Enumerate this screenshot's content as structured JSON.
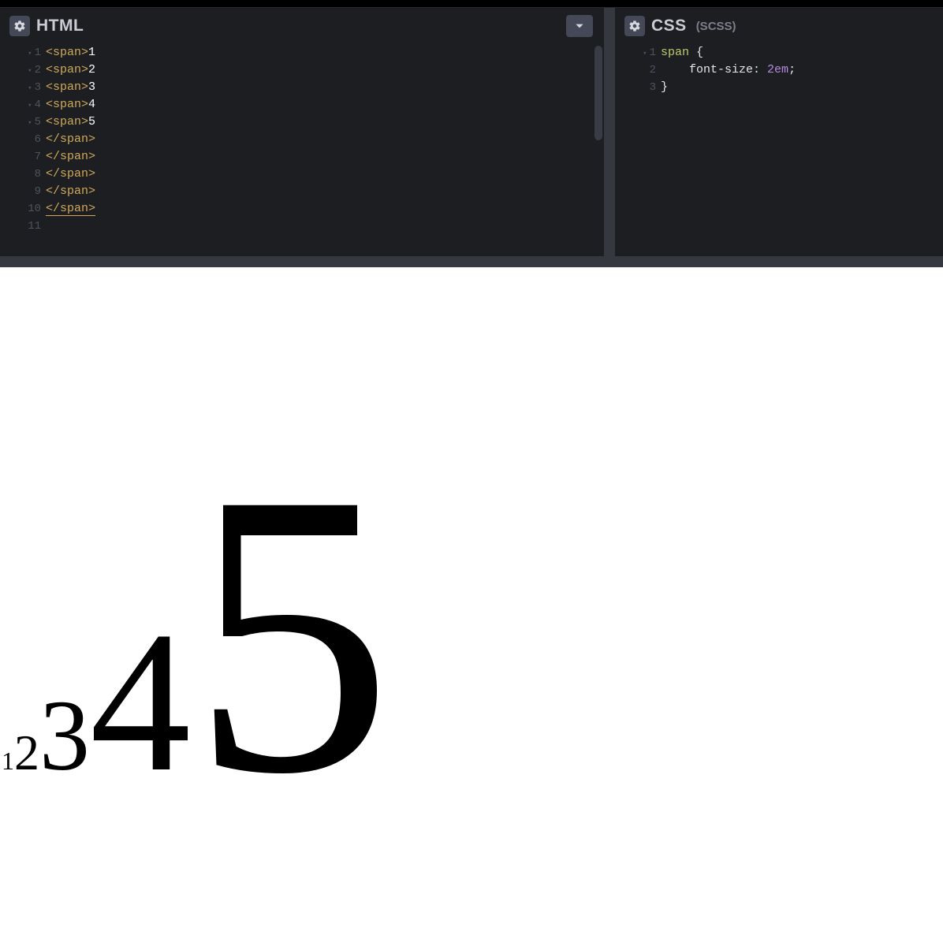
{
  "panes": {
    "html": {
      "title": "HTML",
      "gutter": [
        "1",
        "2",
        "3",
        "4",
        "5",
        "6",
        "7",
        "8",
        "9",
        "10",
        "11"
      ],
      "foldable": [
        true,
        true,
        true,
        true,
        true,
        false,
        false,
        false,
        false,
        false,
        false
      ],
      "lines": [
        {
          "parts": [
            {
              "t": "<",
              "c": "tok-angle"
            },
            {
              "t": "span",
              "c": "tok-tag"
            },
            {
              "t": ">",
              "c": "tok-angle"
            },
            {
              "t": "1",
              "c": "tok-text"
            }
          ]
        },
        {
          "parts": [
            {
              "t": "<",
              "c": "tok-angle"
            },
            {
              "t": "span",
              "c": "tok-tag"
            },
            {
              "t": ">",
              "c": "tok-angle"
            },
            {
              "t": "2",
              "c": "tok-text"
            }
          ]
        },
        {
          "parts": [
            {
              "t": "<",
              "c": "tok-angle"
            },
            {
              "t": "span",
              "c": "tok-tag"
            },
            {
              "t": ">",
              "c": "tok-angle"
            },
            {
              "t": "3",
              "c": "tok-text"
            }
          ]
        },
        {
          "parts": [
            {
              "t": "<",
              "c": "tok-angle"
            },
            {
              "t": "span",
              "c": "tok-tag"
            },
            {
              "t": ">",
              "c": "tok-angle"
            },
            {
              "t": "4",
              "c": "tok-text"
            }
          ]
        },
        {
          "parts": [
            {
              "t": "<",
              "c": "tok-angle"
            },
            {
              "t": "span",
              "c": "tok-tag"
            },
            {
              "t": ">",
              "c": "tok-angle"
            },
            {
              "t": "5",
              "c": "tok-text"
            }
          ]
        },
        {
          "parts": [
            {
              "t": "</",
              "c": "tok-angle"
            },
            {
              "t": "span",
              "c": "tok-tag"
            },
            {
              "t": ">",
              "c": "tok-angle"
            }
          ]
        },
        {
          "parts": [
            {
              "t": "</",
              "c": "tok-angle"
            },
            {
              "t": "span",
              "c": "tok-tag"
            },
            {
              "t": ">",
              "c": "tok-angle"
            }
          ]
        },
        {
          "parts": [
            {
              "t": "</",
              "c": "tok-angle"
            },
            {
              "t": "span",
              "c": "tok-tag"
            },
            {
              "t": ">",
              "c": "tok-angle"
            }
          ]
        },
        {
          "parts": [
            {
              "t": "</",
              "c": "tok-angle"
            },
            {
              "t": "span",
              "c": "tok-tag"
            },
            {
              "t": ">",
              "c": "tok-angle"
            }
          ]
        },
        {
          "parts": [
            {
              "t": "</",
              "c": "tok-angle"
            },
            {
              "t": "span",
              "c": "tok-tag"
            },
            {
              "t": ">",
              "c": "tok-angle"
            }
          ],
          "underline": true
        },
        {
          "parts": []
        }
      ]
    },
    "css": {
      "title": "CSS",
      "subtitle": "(SCSS)",
      "gutter": [
        "1",
        "2",
        "3"
      ],
      "foldable": [
        true,
        false,
        false
      ],
      "lines": [
        {
          "parts": [
            {
              "t": "span",
              "c": "tok-sel"
            },
            {
              "t": " ",
              "c": ""
            },
            {
              "t": "{",
              "c": "tok-brace"
            }
          ]
        },
        {
          "indent": "    ",
          "parts": [
            {
              "t": "font-size",
              "c": "tok-prop"
            },
            {
              "t": ": ",
              "c": "tok-punct"
            },
            {
              "t": "2em",
              "c": "tok-num"
            },
            {
              "t": ";",
              "c": "tok-punct"
            }
          ]
        },
        {
          "parts": [
            {
              "t": "}",
              "c": "tok-brace"
            }
          ]
        }
      ]
    }
  },
  "preview": {
    "values": [
      "1",
      "2",
      "3",
      "4",
      "5"
    ]
  }
}
